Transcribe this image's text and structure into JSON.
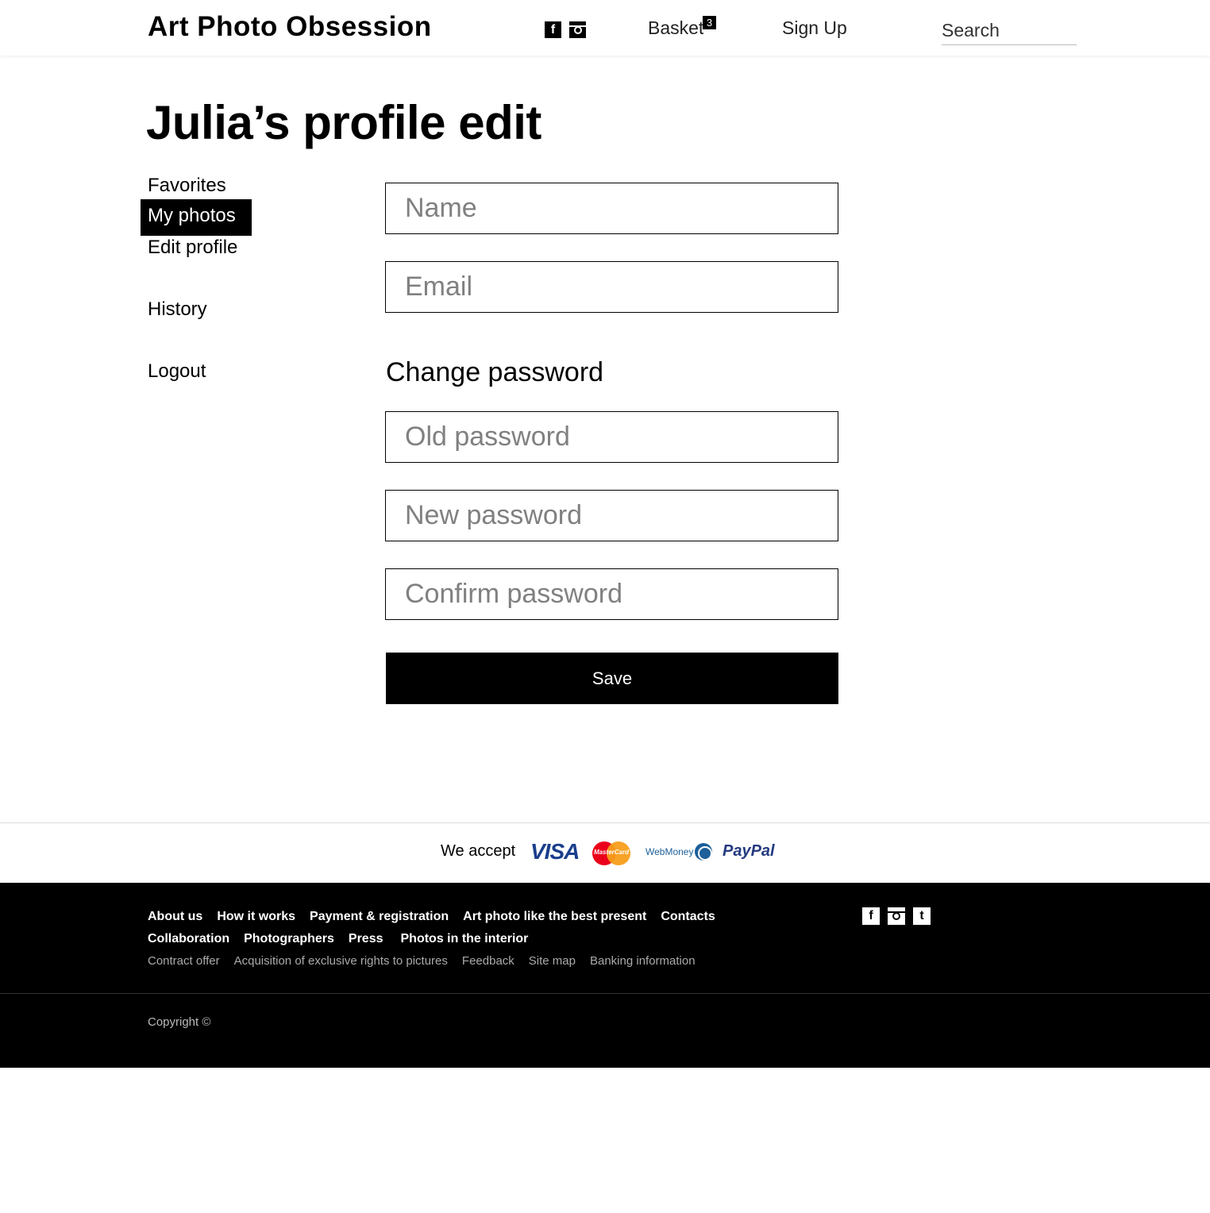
{
  "header": {
    "logo": "Art Photo Obsession",
    "social": [
      "facebook-icon",
      "instagram-icon"
    ],
    "basket_label": "Basket",
    "basket_count": "3",
    "signup_label": "Sign Up",
    "search_placeholder": "Search"
  },
  "page_title": "Julia’s profile edit",
  "sidebar": {
    "items": [
      {
        "label": "Favorites"
      },
      {
        "label": "My photos",
        "active": true
      },
      {
        "label": "Edit profile"
      },
      {
        "label": "History"
      },
      {
        "label": "Logout"
      }
    ]
  },
  "form": {
    "name_placeholder": "Name",
    "email_placeholder": "Email",
    "change_password_title": "Change password",
    "old_password_placeholder": "Old password",
    "new_password_placeholder": "New password",
    "confirm_password_placeholder": "Confirm password",
    "save_label": "Save"
  },
  "payment": {
    "we_accept": "We accept",
    "methods": [
      "VISA",
      "MasterCard",
      "WebMoney",
      "PayPal"
    ]
  },
  "footer": {
    "row1": [
      "About us",
      "How it works",
      "Payment & registration",
      "Art photo like the best present",
      "Contacts"
    ],
    "row2": [
      "Collaboration",
      "Photographers",
      "Press",
      "Photos in the interior"
    ],
    "row3": [
      "Contract offer",
      "Acquisition of exclusive rights to pictures",
      "Feedback",
      "Site map",
      "Banking information"
    ],
    "social": [
      "facebook-icon",
      "instagram-icon",
      "tumblr-icon"
    ],
    "copyright": "Copyright ©"
  },
  "colors": {
    "primary": "#000000",
    "placeholder": "#808080",
    "visa_blue": "#1a3e8c",
    "webmoney_blue": "#1c5f9a"
  }
}
